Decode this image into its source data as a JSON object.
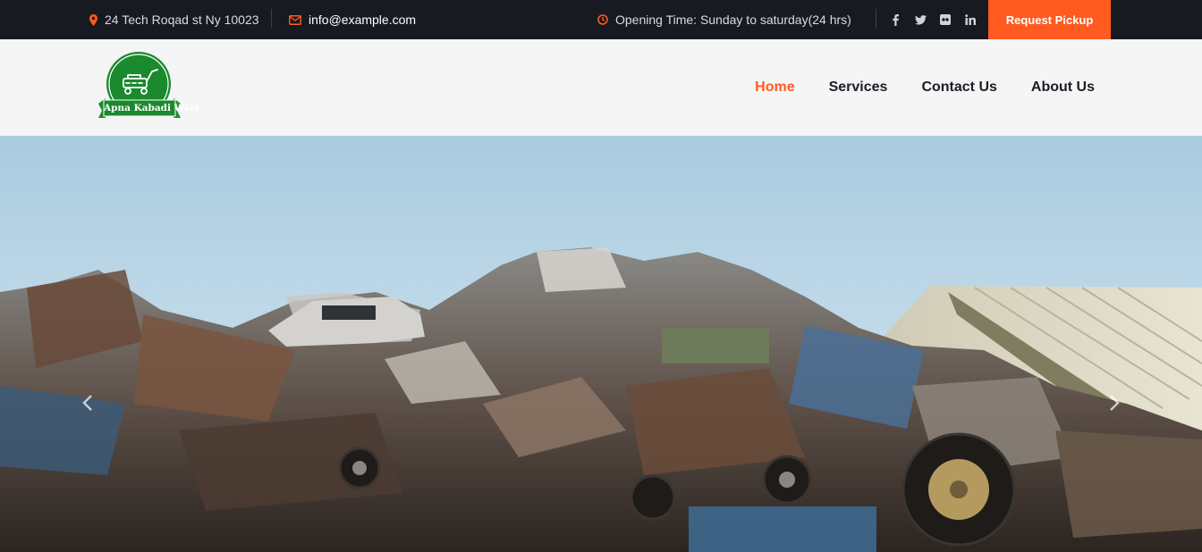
{
  "topbar": {
    "address": "24 Tech Roqad st Ny 10023",
    "email": "info@example.com",
    "opening": "Opening Time: Sunday to saturday(24 hrs)",
    "social": [
      "facebook-icon",
      "twitter-icon",
      "flickr-icon",
      "linkedin-icon"
    ],
    "cta": "Request Pickup"
  },
  "brand": {
    "name": "Apna Kabadi Wala"
  },
  "nav": {
    "items": [
      "Home",
      "Services",
      "Contact Us",
      "About Us"
    ],
    "active": "Home"
  },
  "hero": {
    "prev_icon": "chevron-left-icon",
    "next_icon": "chevron-right-icon"
  },
  "colors": {
    "accent": "#ff5a1f",
    "topbar_bg": "#171a21",
    "logo_green": "#1b8a2e"
  }
}
